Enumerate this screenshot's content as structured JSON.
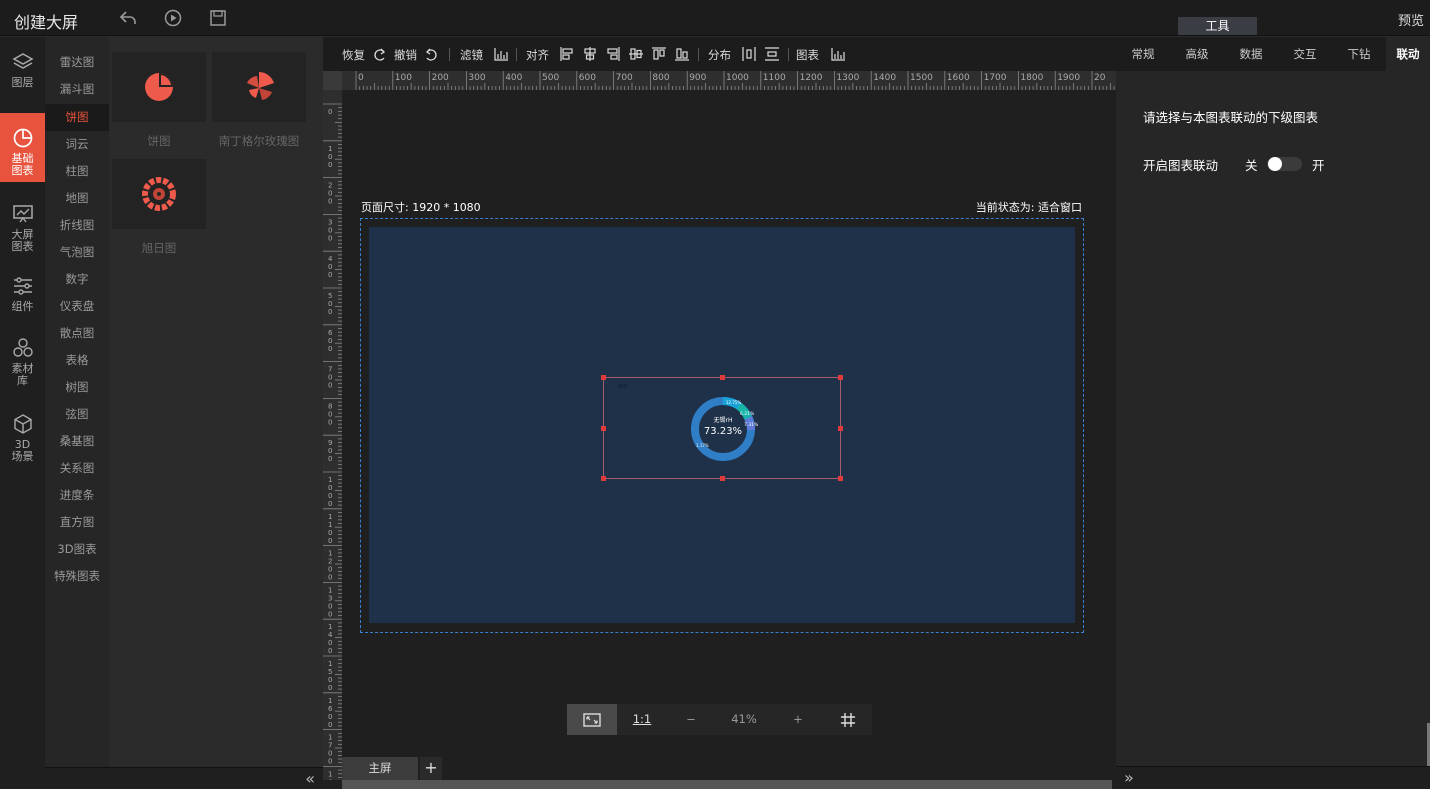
{
  "app": {
    "title": "创建大屏",
    "tool_tab": "工具",
    "preview": "预览"
  },
  "nav": [
    {
      "label": "图层",
      "icon": "layers-icon"
    },
    {
      "label": "基础图表",
      "icon": "pie-chart-icon",
      "active": true
    },
    {
      "label": "大屏图表",
      "icon": "screen-chart-icon"
    },
    {
      "label": "组件",
      "icon": "sliders-icon"
    },
    {
      "label": "素材库",
      "icon": "hexagons-icon"
    },
    {
      "label": "3D场景",
      "icon": "cube-icon"
    }
  ],
  "categories": [
    "雷达图",
    "漏斗图",
    "饼图",
    "词云",
    "柱图",
    "地图",
    "折线图",
    "气泡图",
    "数字",
    "仪表盘",
    "散点图",
    "表格",
    "树图",
    "弦图",
    "桑基图",
    "关系图",
    "进度条",
    "直方图",
    "3D图表",
    "特殊图表"
  ],
  "active_category": "饼图",
  "thumbnails": [
    {
      "label": "饼图",
      "icon": "pie-thumb-icon"
    },
    {
      "label": "南丁格尔玫瑰图",
      "icon": "rose-thumb-icon"
    },
    {
      "label": "旭日图",
      "icon": "sunburst-thumb-icon"
    }
  ],
  "toolbar": {
    "redo": "恢复",
    "undo": "撤销",
    "filter": "滤镜",
    "align": "对齐",
    "distribute": "分布",
    "chart": "图表"
  },
  "ruler": {
    "h_ticks": [
      "0",
      "100",
      "200",
      "300",
      "400",
      "500",
      "600",
      "700",
      "800",
      "900",
      "1000",
      "1100",
      "1200",
      "1300",
      "1400",
      "1500",
      "1600",
      "1700",
      "1800",
      "1900",
      "20"
    ]
  },
  "canvas": {
    "page_size": "页面尺寸: 1920 * 1080",
    "state": "当前状态为: 适合窗口",
    "widget": {
      "center_label": "无锡rH",
      "value": "73.23%",
      "tiny_label": "单位",
      "slice_labels": [
        "12.75%",
        "6.21%",
        "7.31%",
        "1.17%"
      ]
    },
    "zoom": "41%",
    "zoom_actual": "1:1",
    "zoom_minus": "−",
    "zoom_plus": "+",
    "tab_main": "主屏",
    "tab_add": "+"
  },
  "right_panel": {
    "tabs": [
      "常规",
      "高级",
      "数据",
      "交互",
      "下钻",
      "联动"
    ],
    "active_tab": "联动",
    "title": "请选择与本图表联动的下级图表",
    "switch_label": "开启图表联动",
    "off": "关",
    "on": "开",
    "switch_state": false
  },
  "colors": {
    "accent": "#e8533e",
    "canvas_bg": "#1e3149",
    "donut_main": "#2f7ec6",
    "donut_alt1": "#1aa3d9",
    "donut_alt2": "#17b5a8",
    "donut_alt3": "#5f7bd8"
  }
}
